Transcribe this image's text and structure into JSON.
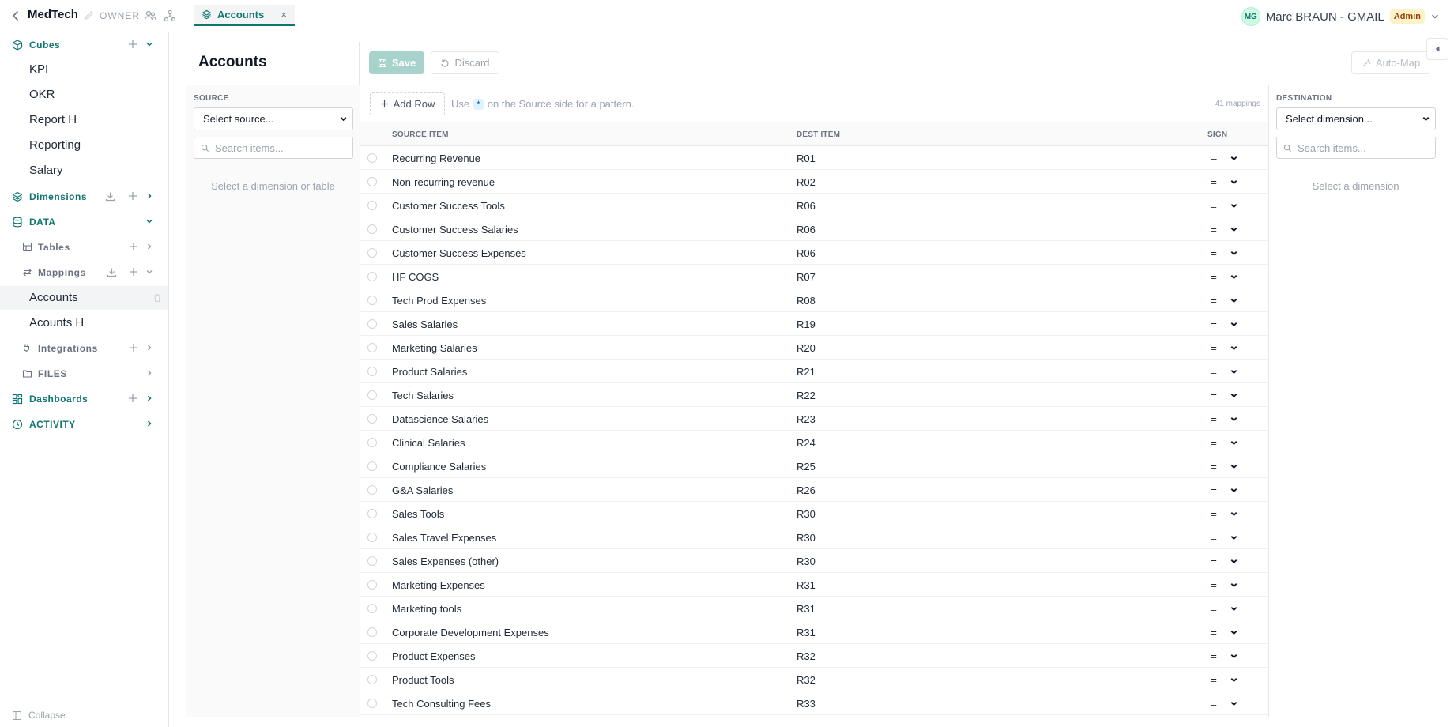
{
  "app": {
    "title": "MedTech",
    "owner_label": "OWNER"
  },
  "tab": {
    "label": "Accounts",
    "close": "×"
  },
  "user": {
    "initials": "MG",
    "name": "Marc BRAUN - GMAIL",
    "role": "Admin"
  },
  "sidebar": {
    "cubes": {
      "label": "Cubes",
      "items": [
        "KPI",
        "OKR",
        "Report H",
        "Reporting",
        "Salary"
      ]
    },
    "dimensions": {
      "label": "Dimensions"
    },
    "data": {
      "label": "DATA"
    },
    "tables": {
      "label": "Tables"
    },
    "mappings": {
      "label": "Mappings",
      "items": [
        "Accounts",
        "Acounts H"
      ]
    },
    "integrations": {
      "label": "Integrations"
    },
    "files": {
      "label": "FILES"
    },
    "dashboards": {
      "label": "Dashboards"
    },
    "activity": {
      "label": "ACTIVITY"
    },
    "collapse": "Collapse"
  },
  "main": {
    "title": "Accounts",
    "save": "Save",
    "discard": "Discard",
    "automap": "Auto-Map",
    "source": {
      "label": "SOURCE",
      "select": "Select source...",
      "search_placeholder": "Search items...",
      "hint": "Select a dimension or table"
    },
    "destination": {
      "label": "DESTINATION",
      "select": "Select dimension...",
      "search_placeholder": "Search items...",
      "hint": "Select a dimension"
    },
    "add_row": "Add Row",
    "hint_pre": "Use",
    "hint_star": "*",
    "hint_post": "on the Source side for a pattern.",
    "mapping_count": "41 mappings",
    "columns": {
      "source": "SOURCE ITEM",
      "dest": "DEST ITEM",
      "sign": "SIGN"
    }
  },
  "rows": [
    {
      "source": "Recurring Revenue",
      "dest": "R01",
      "sign": "–"
    },
    {
      "source": "Non-recurring revenue",
      "dest": "R02",
      "sign": "="
    },
    {
      "source": "Customer Success Tools",
      "dest": "R06",
      "sign": "="
    },
    {
      "source": "Customer Success Salaries",
      "dest": "R06",
      "sign": "="
    },
    {
      "source": "Customer Success Expenses",
      "dest": "R06",
      "sign": "="
    },
    {
      "source": "HF COGS",
      "dest": "R07",
      "sign": "="
    },
    {
      "source": "Tech Prod Expenses",
      "dest": "R08",
      "sign": "="
    },
    {
      "source": "Sales Salaries",
      "dest": "R19",
      "sign": "="
    },
    {
      "source": "Marketing Salaries",
      "dest": "R20",
      "sign": "="
    },
    {
      "source": "Product Salaries",
      "dest": "R21",
      "sign": "="
    },
    {
      "source": "Tech Salaries",
      "dest": "R22",
      "sign": "="
    },
    {
      "source": "Datascience Salaries",
      "dest": "R23",
      "sign": "="
    },
    {
      "source": "Clinical Salaries",
      "dest": "R24",
      "sign": "="
    },
    {
      "source": "Compliance Salaries",
      "dest": "R25",
      "sign": "="
    },
    {
      "source": "G&A Salaries",
      "dest": "R26",
      "sign": "="
    },
    {
      "source": "Sales Tools",
      "dest": "R30",
      "sign": "="
    },
    {
      "source": "Sales Travel Expenses",
      "dest": "R30",
      "sign": "="
    },
    {
      "source": "Sales Expenses (other)",
      "dest": "R30",
      "sign": "="
    },
    {
      "source": "Marketing Expenses",
      "dest": "R31",
      "sign": "="
    },
    {
      "source": "Marketing tools",
      "dest": "R31",
      "sign": "="
    },
    {
      "source": "Corporate Development Expenses",
      "dest": "R31",
      "sign": "="
    },
    {
      "source": "Product Expenses",
      "dest": "R32",
      "sign": "="
    },
    {
      "source": "Product Tools",
      "dest": "R32",
      "sign": "="
    },
    {
      "source": "Tech Consulting Fees",
      "dest": "R33",
      "sign": "="
    }
  ],
  "colors": {
    "accent": "#0f766e",
    "save_disabled": "#a7d3cc",
    "admin_badge": "#fef3c7"
  }
}
